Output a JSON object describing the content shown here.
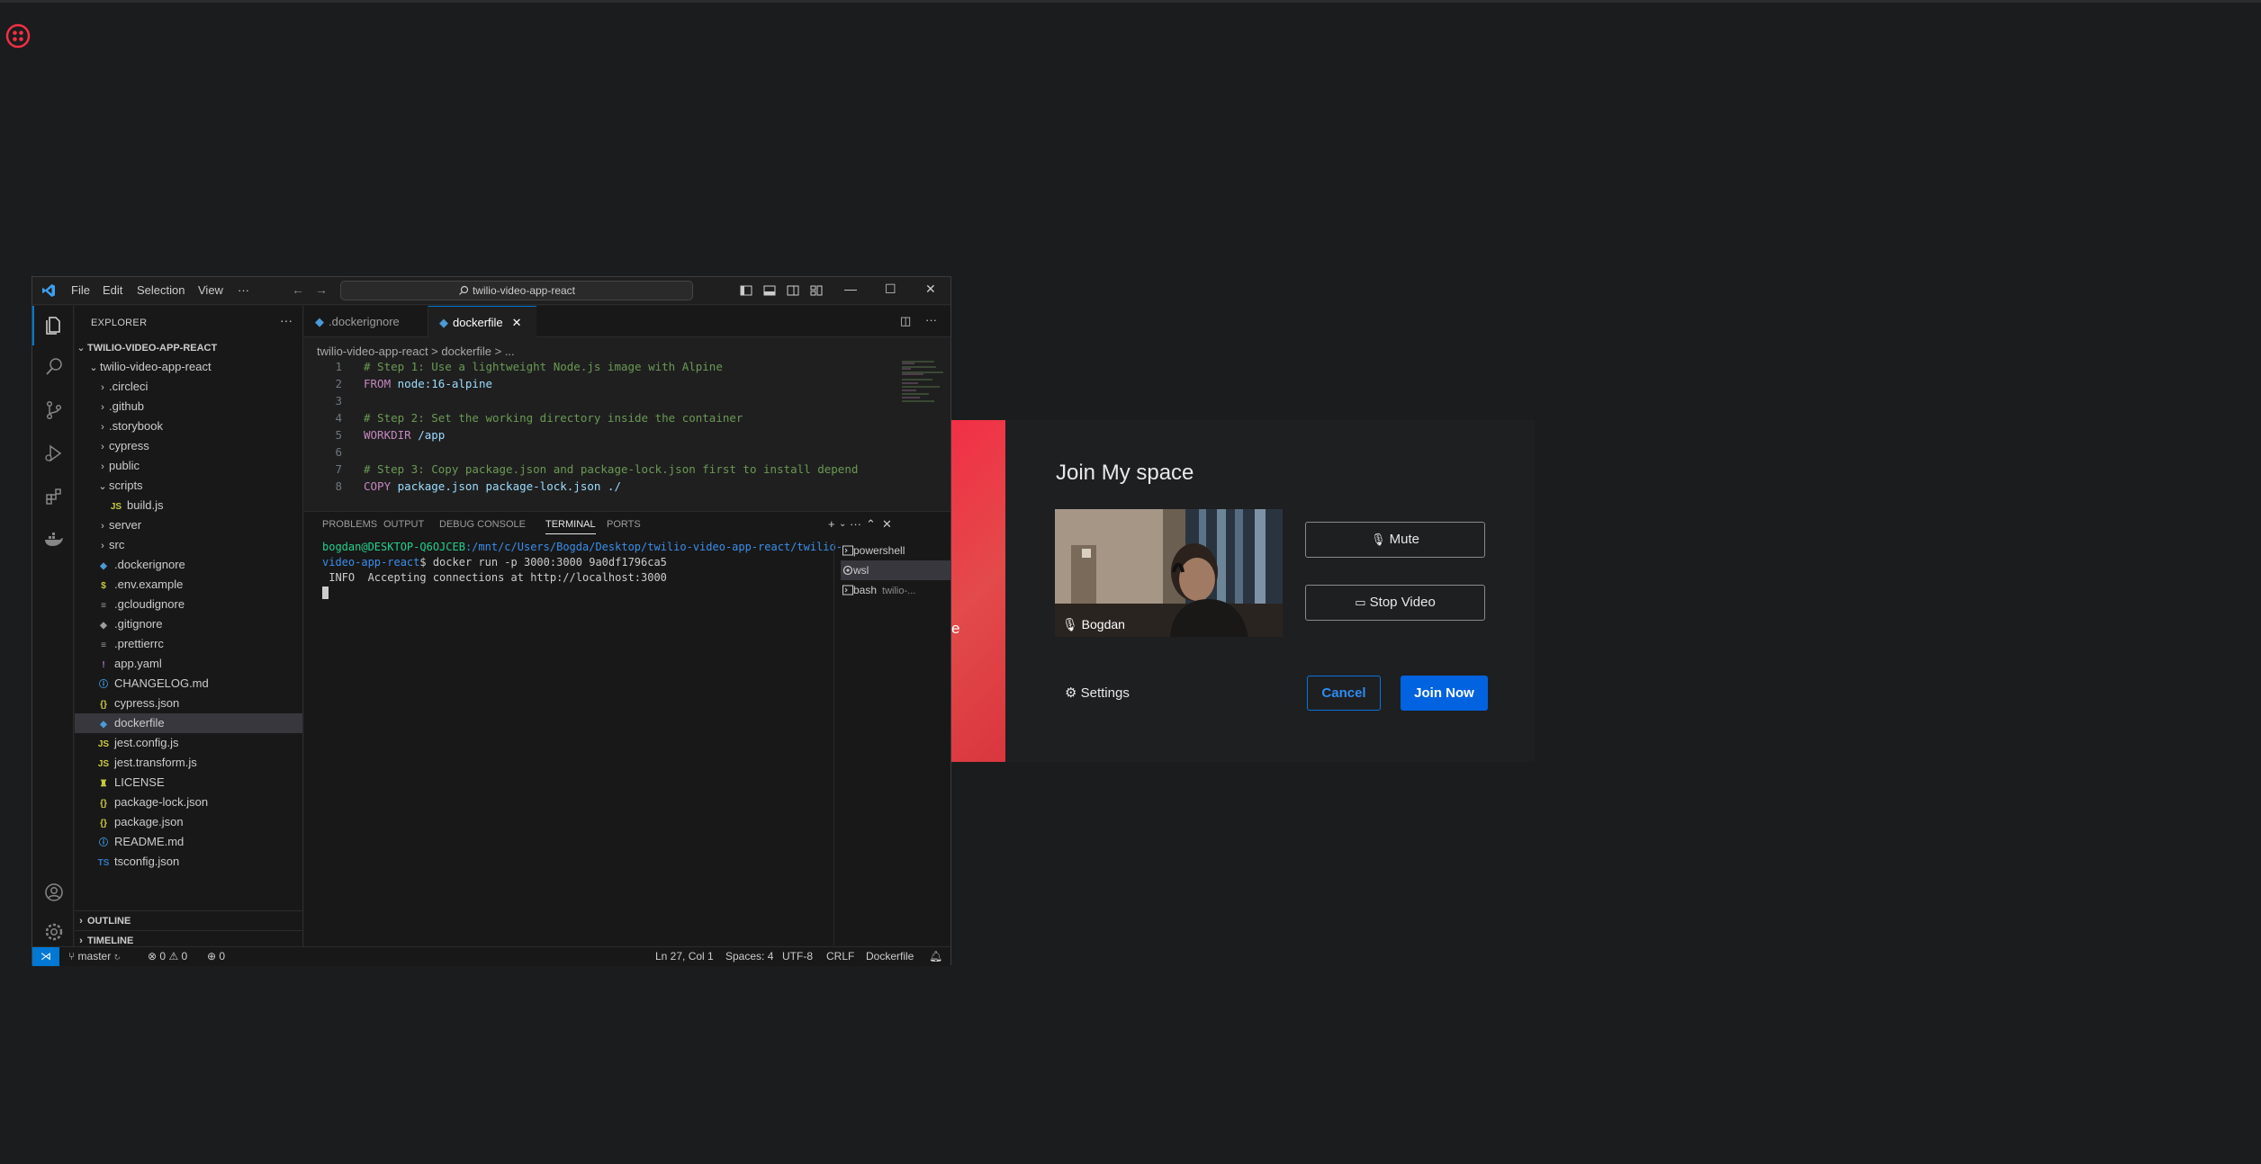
{
  "vscode": {
    "menu": [
      "File",
      "Edit",
      "Selection",
      "View",
      "···"
    ],
    "search": "twilio-video-app-react",
    "explorer_title": "EXPLORER",
    "workspace": "TWILIO-VIDEO-APP-REACT",
    "root_folder": "twilio-video-app-react",
    "tree": [
      {
        "label": ".circleci",
        "kind": "folder",
        "collapsed": true
      },
      {
        "label": ".github",
        "kind": "folder",
        "collapsed": true
      },
      {
        "label": ".storybook",
        "kind": "folder",
        "collapsed": true
      },
      {
        "label": "cypress",
        "kind": "folder",
        "collapsed": true
      },
      {
        "label": "public",
        "kind": "folder",
        "collapsed": true
      },
      {
        "label": "scripts",
        "kind": "folder",
        "collapsed": false
      },
      {
        "label": "build.js",
        "kind": "js",
        "nested": true
      },
      {
        "label": "server",
        "kind": "folder",
        "collapsed": true
      },
      {
        "label": "src",
        "kind": "folder",
        "collapsed": true
      },
      {
        "label": ".dockerignore",
        "kind": "docker"
      },
      {
        "label": ".env.example",
        "kind": "env"
      },
      {
        "label": ".gcloudignore",
        "kind": "text"
      },
      {
        "label": ".gitignore",
        "kind": "git"
      },
      {
        "label": ".prettierrc",
        "kind": "text"
      },
      {
        "label": "app.yaml",
        "kind": "yaml"
      },
      {
        "label": "CHANGELOG.md",
        "kind": "info"
      },
      {
        "label": "cypress.json",
        "kind": "json"
      },
      {
        "label": "dockerfile",
        "kind": "docker",
        "selected": true
      },
      {
        "label": "jest.config.js",
        "kind": "js"
      },
      {
        "label": "jest.transform.js",
        "kind": "js"
      },
      {
        "label": "LICENSE",
        "kind": "license"
      },
      {
        "label": "package-lock.json",
        "kind": "json"
      },
      {
        "label": "package.json",
        "kind": "json"
      },
      {
        "label": "README.md",
        "kind": "info"
      },
      {
        "label": "tsconfig.json",
        "kind": "ts"
      }
    ],
    "outline": "OUTLINE",
    "timeline": "TIMELINE",
    "tabs": [
      {
        "label": ".dockerignore",
        "active": false
      },
      {
        "label": "dockerfile",
        "active": true
      }
    ],
    "breadcrumb": "twilio-video-app-react  >  dockerfile  >  ...",
    "code_lines": [
      {
        "n": "1",
        "parts": [
          {
            "t": "# Step 1: Use a lightweight Node.js image with Alpine",
            "c": "cm"
          }
        ]
      },
      {
        "n": "2",
        "parts": [
          {
            "t": "FROM ",
            "c": "kw"
          },
          {
            "t": "node",
            "c": "str"
          },
          {
            "t": ":16-alpine",
            "c": "str"
          }
        ]
      },
      {
        "n": "3",
        "parts": []
      },
      {
        "n": "4",
        "parts": [
          {
            "t": "# Step 2: Set the working directory inside the container",
            "c": "cm"
          }
        ]
      },
      {
        "n": "5",
        "parts": [
          {
            "t": "WORKDIR ",
            "c": "kw"
          },
          {
            "t": "/app",
            "c": "str"
          }
        ]
      },
      {
        "n": "6",
        "parts": []
      },
      {
        "n": "7",
        "parts": [
          {
            "t": "# Step 3: Copy package.json and package-lock.json first to install depend",
            "c": "cm"
          }
        ]
      },
      {
        "n": "8",
        "parts": [
          {
            "t": "COPY ",
            "c": "kw"
          },
          {
            "t": "package.json package-lock.json ./",
            "c": "str"
          }
        ]
      }
    ],
    "panel_tabs": [
      "PROBLEMS",
      "OUTPUT",
      "DEBUG CONSOLE",
      "TERMINAL",
      "PORTS"
    ],
    "terminal": {
      "prompt_user": "bogdan@DESKTOP-Q6OJCEB",
      "prompt_path_1": ":/mnt/c/Users/Bogda/Desktop/twilio-video-app-react/twilio-",
      "prompt_path_2": "video-app-react",
      "command": "$ docker run -p 3000:3000 9a0df1796ca5",
      "output": " INFO  Accepting connections at http://localhost:3000"
    },
    "terminal_list": [
      {
        "label": "powershell",
        "sub": ""
      },
      {
        "label": "wsl",
        "sub": ""
      },
      {
        "label": "bash",
        "sub": "twilio-..."
      }
    ],
    "status": {
      "branch": "master",
      "errors": "0",
      "warnings": "0",
      "ports": "0",
      "cursor": "Ln 27, Col 1",
      "spaces": "Spaces: 4",
      "encoding": "UTF-8",
      "eol": "CRLF",
      "language": "Dockerfile"
    }
  },
  "join": {
    "side_text": "e",
    "title": "Join My space",
    "participant": "Bogdan",
    "mute": "Mute",
    "stop_video": "Stop Video",
    "settings": "Settings",
    "cancel": "Cancel",
    "join_now": "Join Now"
  },
  "colors": {
    "accent": "#0078d4",
    "twilio_red": "#f22f46",
    "join_button": "#0263e0"
  }
}
